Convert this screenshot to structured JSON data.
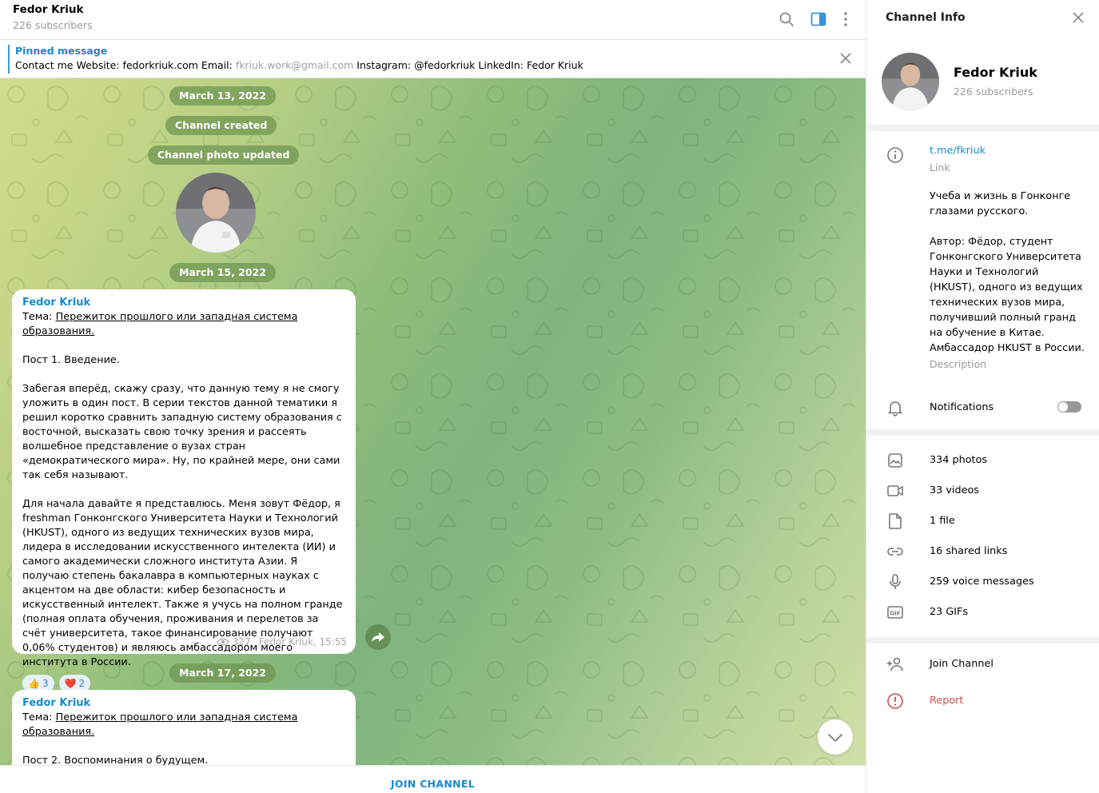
{
  "header": {
    "title": "Fedor Kriuk",
    "subtitle": "226 subscribers",
    "icons": [
      "search-icon",
      "sidebar-toggle-icon",
      "more-vertical-icon"
    ]
  },
  "pinned": {
    "title": "Pinned message",
    "text_before": "Contact me Website: fedorkriuk.com Email: ",
    "email": "fkriuk.work@gmail.com",
    "text_after": " Instagram: @fedorkriuk LinkedIn: Fedor Kriuk"
  },
  "chat": {
    "date_1": "March 13, 2022",
    "service_created": "Channel created",
    "service_photo": "Channel photo updated",
    "date_2": "March 15, 2022",
    "date_3": "March 17, 2022",
    "message_1": {
      "author": "Fedor Kriuk",
      "topic_prefix": "Тема: ",
      "topic_link": "Пережиток прошлого или западная система образования.",
      "title": "Пост 1. Введение.",
      "para_1": "Забегая вперёд, скажу сразу, что данную тему я не смогу уложить в один пост. В серии текстов данной тематики я решил коротко сравнить западную систему образования с восточной, высказать свою точку зрения и рассеять волшебное представление о вузах стран «демократического мира». Ну, по крайней мере, они сами так себя называют.",
      "para_2": "Для начала давайте я представлюсь. Меня зовут Фёдор, я freshman Гонконгского Университета Науки и Технологий (HKUST), одного из ведущих технических вузов мира, лидера в исследовании искусственного интелекта (ИИ) и самого академически сложного института Азии. Я получаю степень бакалавра в компьютерных науках с акцентом на две области: кибер безопасность и искусственный интелект. Также я учусь на полном гранде (полная оплата обучения, проживания и перелетов за счёт университета, такое финансирование получают 0,06% студентов) и являюсь амбассадором моего института в России.",
      "reactions": [
        {
          "emoji": "👍",
          "count": "3"
        },
        {
          "emoji": "❤️",
          "count": "2"
        }
      ],
      "views": "327",
      "signature": "Fedor Kriuk, 15:55"
    },
    "message_2": {
      "author": "Fedor Kriuk",
      "topic_prefix": "Тема: ",
      "topic_link": "Пережиток прошлого или западная система образования.",
      "title": "Пост 2. Воспоминания о будущем."
    }
  },
  "join": {
    "label": "JOIN CHANNEL"
  },
  "panel": {
    "title": "Channel Info",
    "name": "Fedor Kriuk",
    "subscribers": "226 subscribers",
    "link": "t.me/fkriuk",
    "link_hint": "Link",
    "description_1": "Учеба и жизнь в Гонконге глазами русского.",
    "description_2": "Автор: Фёдор, студент Гонконгского Университета Науки и Технологий (HKUST), одного из ведущих технических вузов мира, получивший полный гранд на обучение в Китае. Амбассадор HKUST в России.",
    "description_hint": "Description",
    "notifications": "Notifications",
    "notifications_on": false,
    "media": [
      {
        "icon": "photo-icon",
        "label": "334 photos"
      },
      {
        "icon": "video-icon",
        "label": "33 videos"
      },
      {
        "icon": "file-icon",
        "label": "1 file"
      },
      {
        "icon": "link-icon",
        "label": "16 shared links"
      },
      {
        "icon": "microphone-icon",
        "label": "259 voice messages"
      },
      {
        "icon": "gif-icon",
        "label": "23 GIFs"
      }
    ],
    "join_channel": "Join Channel",
    "report": "Report"
  },
  "colors": {
    "accent": "#168acd",
    "report": "#d14e4e",
    "service_bubble": "#70964f"
  }
}
